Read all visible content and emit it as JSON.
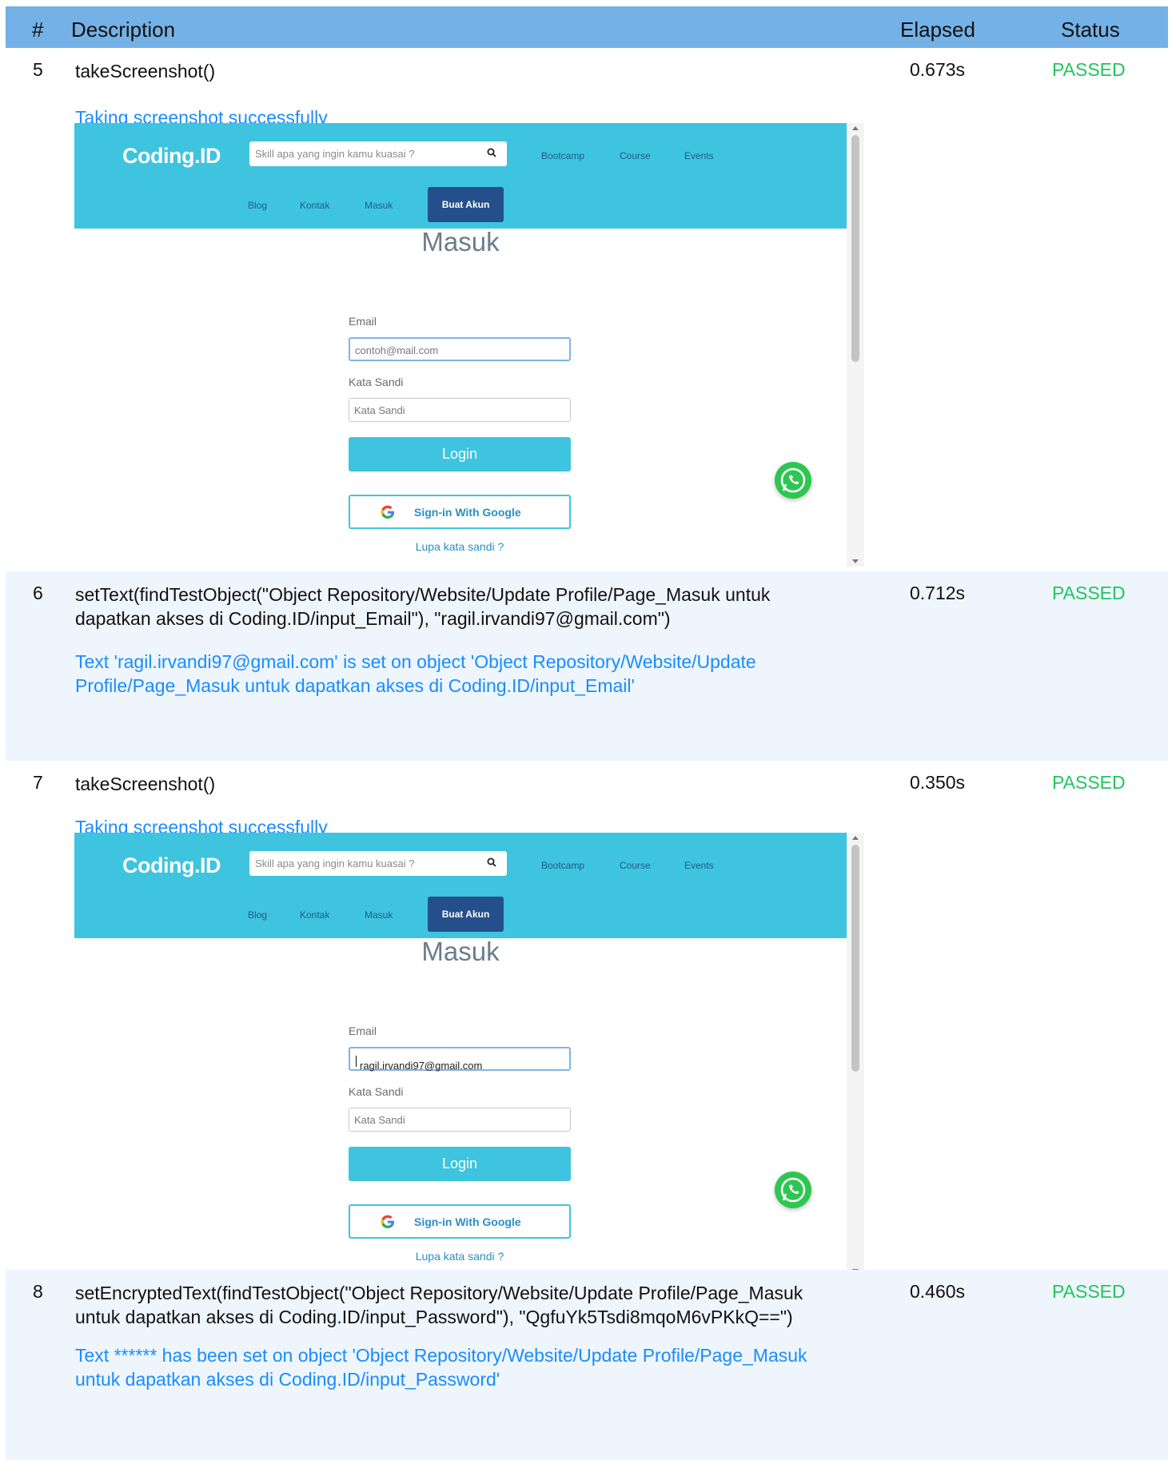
{
  "header": {
    "num": "#",
    "description": "Description",
    "elapsed": "Elapsed",
    "status": "Status"
  },
  "status_color": "#22c55e",
  "message_color": "#1a8cff",
  "steps": [
    {
      "num": "5",
      "description": "takeScreenshot()",
      "elapsed": "0.673s",
      "status": "PASSED",
      "message": "Taking screenshot successfully"
    },
    {
      "num": "6",
      "description": "setText(findTestObject(\"Object Repository/Website/Update Profile/Page_Masuk untuk dapatkan akses di Coding.ID/input_Email\"), \"ragil.irvandi97@gmail.com\")",
      "elapsed": "0.712s",
      "status": "PASSED",
      "message": "Text 'ragil.irvandi97@gmail.com' is set on object 'Object Repository/Website/Update Profile/Page_Masuk untuk dapatkan akses di Coding.ID/input_Email'"
    },
    {
      "num": "7",
      "description": "takeScreenshot()",
      "elapsed": "0.350s",
      "status": "PASSED",
      "message": "Taking screenshot successfully"
    },
    {
      "num": "8",
      "description": "setEncryptedText(findTestObject(\"Object Repository/Website/Update Profile/Page_Masuk untuk dapatkan akses di Coding.ID/input_Password\"), \"QgfuYk5Tsdi8mqoM6vPKkQ==\")",
      "elapsed": "0.460s",
      "status": "PASSED",
      "message": "Text ****** has been set on object 'Object Repository/Website/Update Profile/Page_Masuk untuk dapatkan akses di Coding.ID/input_Password'"
    }
  ],
  "site": {
    "brand": "Coding.ID",
    "search_placeholder": "Skill apa yang ingin kamu kuasai ?",
    "nav": [
      "Bootcamp",
      "Course",
      "Events",
      "Blog",
      "Kontak",
      "Masuk"
    ],
    "signup": "Buat Akun",
    "page_title": "Masuk",
    "email_label": "Email",
    "email_placeholder": "contoh@mail.com",
    "email_value": "ragil.irvandi97@gmail.com",
    "password_label": "Kata Sandi",
    "password_placeholder": "Kata Sandi",
    "login": "Login",
    "google": "Sign-in With Google",
    "forgot": "Lupa kata sandi ?",
    "accent": "#3ec4de",
    "signup_color": "#254f8a"
  }
}
